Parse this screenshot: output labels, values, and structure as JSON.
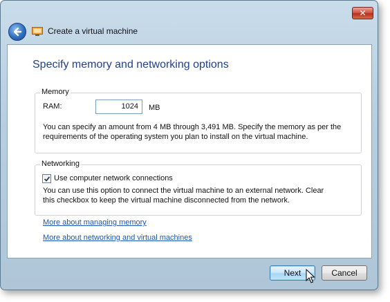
{
  "window": {
    "title": "Create a virtual machine",
    "close_label": "✕"
  },
  "page": {
    "heading": "Specify memory and networking options"
  },
  "memory": {
    "group_label": "Memory",
    "ram_label": "RAM:",
    "ram_value": "1024",
    "ram_unit": "MB",
    "description_line1": "You can specify an amount from 4 MB through 3,491 MB. Specify the memory as per the",
    "description_line2": "requirements of the operating system you plan to install on the virtual machine."
  },
  "networking": {
    "group_label": "Networking",
    "checkbox_label": "Use computer network connections",
    "checkbox_checked": true,
    "description_line1": "You can use this option to connect the virtual machine to an external network. Clear",
    "description_line2": "this checkbox to keep the virtual machine disconnected from the network."
  },
  "links": {
    "memory": "More about managing memory",
    "networking": "More about networking and virtual machines"
  },
  "buttons": {
    "next": "Next",
    "cancel": "Cancel"
  },
  "colors": {
    "heading": "#1f3f8f",
    "link": "#1a55b8",
    "frame": "#b8cfe0",
    "close_button": "#c23d26"
  },
  "icons": {
    "back": "back-arrow-icon",
    "app": "virtual-machine-icon",
    "close": "close-icon",
    "check": "checkmark-icon",
    "cursor": "mouse-pointer-icon"
  }
}
